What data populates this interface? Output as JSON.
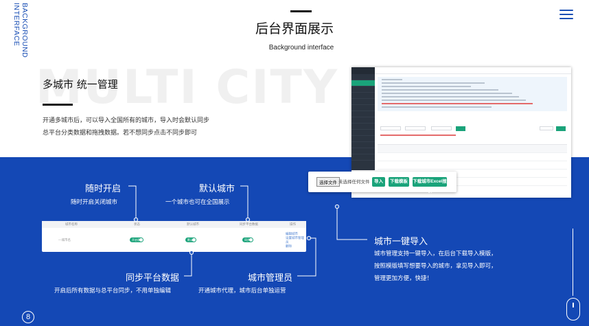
{
  "side_label": {
    "line1": "BACKGROUND",
    "line2": "INTERFACE"
  },
  "header": {
    "title": "后台界面展示",
    "subtitle": "Background interface"
  },
  "menu_icon": "hamburger-menu-icon",
  "intro": {
    "watermark": "MULTI CITY",
    "heading": "多城市 统一管理",
    "description": "开通多城市后，可以导入全国所有的城市，导入时会默认同步总平台分类数据和拖拽数据。若不想同步点击不同步即可"
  },
  "import_bar": {
    "choose_file": "选择文件",
    "no_file": "未选择任何文件",
    "import": "导入",
    "download_template": "下载模板",
    "download_city_excel": "下载城市Excel报表"
  },
  "city_table": {
    "headers": [
      "城市名称",
      "状态",
      "默认城市",
      "同步平台数据",
      "操作"
    ],
    "row_city": "—城市名",
    "status_toggle": "开启状态",
    "default_toggle": "默认",
    "sync_toggle": "同步",
    "ops": [
      "编辑城市",
      "设置城市管理员",
      "删除"
    ]
  },
  "callouts": {
    "open_anytime": {
      "title": "随时开启",
      "desc": "随时开启关闭城市"
    },
    "default_city": {
      "title": "默认城市",
      "desc": "一个城市也可在全国展示"
    },
    "sync_data": {
      "title": "同步平台数据",
      "desc": "开启后所有数据与总平台同步，不用单独编辑"
    },
    "city_admin": {
      "title": "城市管理员",
      "desc": "开通城市代理，城市后台单独运营"
    },
    "one_click_import": {
      "title": "城市一键导入",
      "lines": [
        "城市管理支持一键导入，在后台下载导入模版，",
        "按照模版填写想要导入的城市，拿见导入即可，",
        "管理更加方便，快捷！"
      ]
    }
  },
  "page_number": "8",
  "colors": {
    "brand_blue": "#1448b5",
    "accent_green": "#1aa37a"
  },
  "mouse_icon": "scroll-mouse-icon"
}
